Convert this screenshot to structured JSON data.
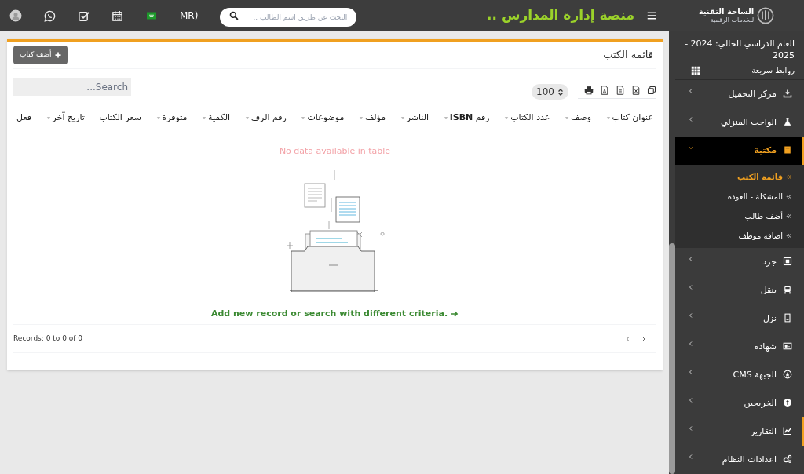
{
  "header": {
    "logo_text": "الساحة التقنية",
    "logo_subtext": "للخدمات الرقمية",
    "title": "منصة إدارة المدارس ..",
    "search": {
      "placeholder": "البحث عن طريق اسم الطالب .."
    },
    "language": "MR)"
  },
  "sidebar": {
    "academic_year": "العام الدراسي الحالي: 2024 - 2025",
    "quick_links": "روابط سريعة",
    "items": [
      {
        "label": "مركز التحميل",
        "selected": false,
        "expanded": false,
        "highlighted": false
      },
      {
        "label": "الواجب المنزلي",
        "selected": false,
        "expanded": false,
        "highlighted": false
      },
      {
        "label": "مكتبة",
        "selected": true,
        "expanded": true,
        "highlighted": false,
        "children": [
          {
            "label": "قائمة الكتب",
            "selected": true
          },
          {
            "label": "المشكلة - العودة",
            "selected": false
          },
          {
            "label": "أضف طالب",
            "selected": false
          },
          {
            "label": "اضافة موظف",
            "selected": false
          }
        ]
      },
      {
        "label": "جرد",
        "selected": false,
        "expanded": false,
        "highlighted": false
      },
      {
        "label": "ينقل",
        "selected": false,
        "expanded": false,
        "highlighted": false
      },
      {
        "label": "نزل",
        "selected": false,
        "expanded": false,
        "highlighted": false
      },
      {
        "label": "شهادة",
        "selected": false,
        "expanded": false,
        "highlighted": false
      },
      {
        "label": "الجبهة CMS",
        "selected": false,
        "expanded": false,
        "highlighted": false
      },
      {
        "label": "الخريجين",
        "selected": false,
        "expanded": false,
        "highlighted": false
      },
      {
        "label": "التقارير",
        "selected": false,
        "expanded": false,
        "highlighted": true
      },
      {
        "label": "اعدادات النظام",
        "selected": false,
        "expanded": false,
        "highlighted": false
      }
    ]
  },
  "card": {
    "title": "قائمة الكتب",
    "add_button": "أضف كتاب",
    "page_size": "100",
    "search": {
      "placeholder": "Search..."
    },
    "table": {
      "columns": [
        {
          "label": "عنوان كتاب",
          "sortable": true
        },
        {
          "label": "وصف",
          "sortable": true
        },
        {
          "label": "عدد الكتاب",
          "sortable": true
        },
        {
          "label": "رقم **ISBN**",
          "sortable": true
        },
        {
          "label": "الناشر",
          "sortable": true
        },
        {
          "label": "مؤلف",
          "sortable": true
        },
        {
          "label": "موضوعات",
          "sortable": true
        },
        {
          "label": "رقم الرف",
          "sortable": true
        },
        {
          "label": "الكمية",
          "sortable": true
        },
        {
          "label": "متوفرة",
          "sortable": true
        },
        {
          "label": "سعر الكتاب",
          "sortable": false
        },
        {
          "label": "تاريخ آخر",
          "sortable": true
        },
        {
          "label": "فعل",
          "sortable": false
        }
      ],
      "empty_message": "No data available in table",
      "empty_link": "Add new record or search with different criteria."
    },
    "records": "Records: 0 to 0 of 0"
  }
}
